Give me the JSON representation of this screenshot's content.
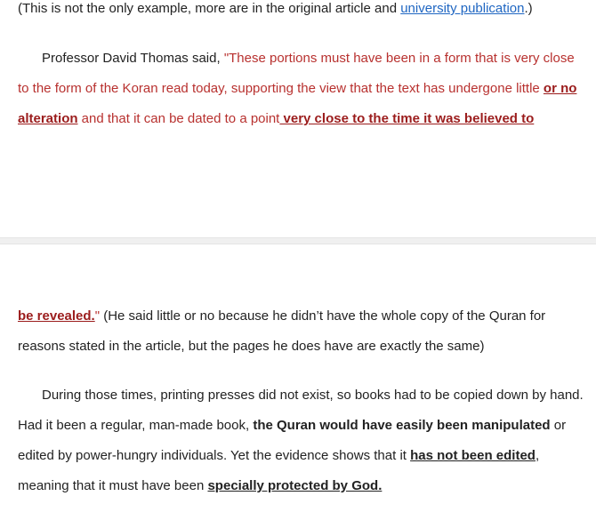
{
  "p0": {
    "text_before": "(This is not the only example, more are in the original article and ",
    "link": "university publication",
    "text_after": ".)"
  },
  "p1": {
    "intro": "Professor David Thomas said, ",
    "quote_open": "\"These portions must have been in a form that is very close to the form of the Koran read today, supporting the view that the text has undergone little ",
    "em1": "or no alteration",
    "mid": " and that it can be dated to a point",
    "em2": " very close to the time it was believed to"
  },
  "p2": {
    "em3": "be revealed.",
    "quote_close": "\"",
    "aside": "  (He said little or no because he didn’t have the whole copy of the Quran for reasons stated in the article, but the pages he does have are exactly the same)"
  },
  "p3": {
    "t1": "During those times, printing presses did not exist, so books had to be copied down by hand. Had it been a regular, man-made book, ",
    "b1": "the Quran would have easily been manipulated",
    "t2": " or edited by power-hungry individuals.  Yet the evidence shows that it ",
    "b2": "has not been edited",
    "t3": ", meaning that it must have been ",
    "b3": "specially protected by God."
  }
}
